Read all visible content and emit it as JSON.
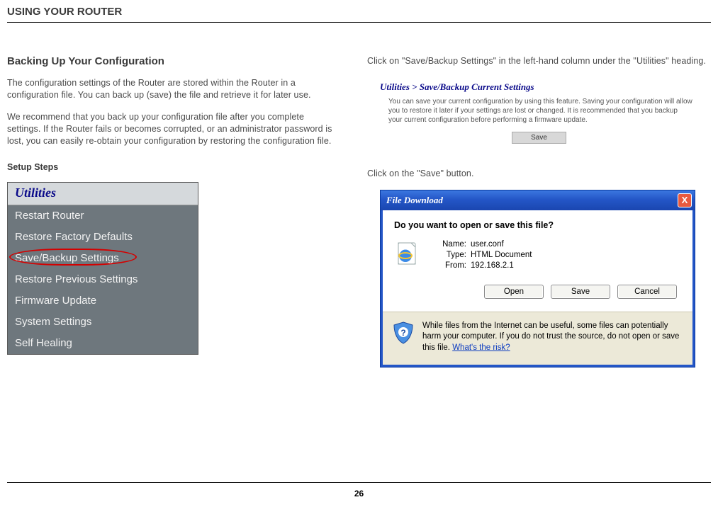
{
  "header": {
    "title": "USING YOUR ROUTER"
  },
  "left": {
    "section_title": "Backing Up Your Configuration",
    "para1": "The configuration settings of the Router are stored within the Router in a configuration file. You can back up (save) the file and retrieve it for later use.",
    "para2": "We recommend that you back up your configuration file after you complete settings. If the Router fails or becomes corrupted, or an administrator password is lost, you can easily re-obtain your configuration by restoring the configuration file.",
    "setup_steps": "Setup Steps",
    "util_header": "Utilities",
    "util_items": [
      "Restart Router",
      "Restore Factory Defaults",
      "Save/Backup Settings",
      "Restore Previous Settings",
      "Firmware Update",
      "System Settings",
      "Self Healing"
    ]
  },
  "right": {
    "intro1": "Click on \"Save/Backup Settings\" in the left-hand column under the \"Utilities\" heading.",
    "blue_heading": "Utilities > Save/Backup Current Settings",
    "desc": "You can save your current configuration by using this feature. Saving your configuration will allow you to restore it later if your settings are lost or changed. It is recommended that you backup your current configuration before performing a firmware update.",
    "save_btn": "Save",
    "intro2": "Click on the \"Save\" button.",
    "dialog": {
      "title": "File Download",
      "close": "X",
      "question": "Do you want to open or save this file?",
      "name_k": "Name:",
      "name_v": "user.conf",
      "type_k": "Type:",
      "type_v": "HTML Document",
      "from_k": "From:",
      "from_v": "192.168.2.1",
      "btn_open": "Open",
      "btn_save": "Save",
      "btn_cancel": "Cancel",
      "warn": "While files from the Internet can be useful, some files can potentially harm your computer. If you do not trust the source, do not open or save this file. ",
      "warn_link": "What's the risk?"
    }
  },
  "page_number": "26"
}
